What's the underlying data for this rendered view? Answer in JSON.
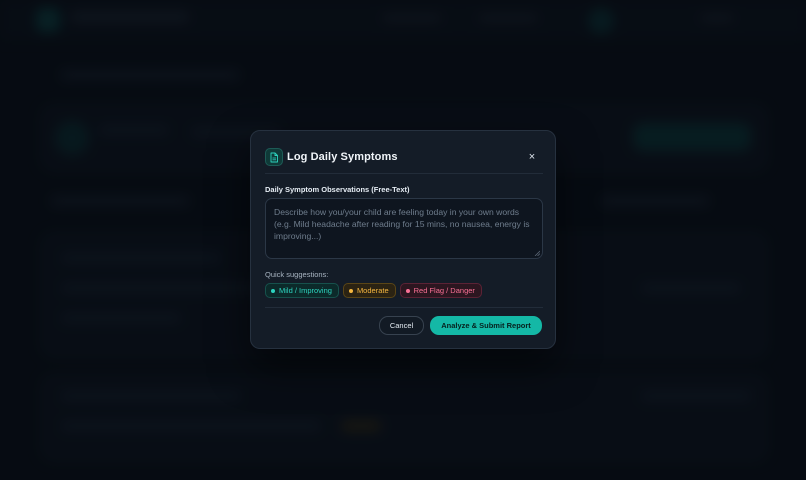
{
  "modal": {
    "title": "Log Daily Symptoms",
    "close_label": "×",
    "field_label": "Daily Symptom Observations (Free-Text)",
    "textarea_value": "",
    "textarea_placeholder": "Describe how you/your child are feeling today in your own words (e.g. Mild headache after reading for 15 mins, no nausea, energy is improving...)",
    "quick_label": "Quick suggestions:",
    "chips": [
      {
        "label": "Mild / Improving",
        "color": "#2dd4bf"
      },
      {
        "label": "Moderate",
        "color": "#f5b740"
      },
      {
        "label": "Red Flag / Danger",
        "color": "#fb7196"
      }
    ],
    "cancel_label": "Cancel",
    "submit_label": "Analyze & Submit Report",
    "icon": "document-icon"
  },
  "colors": {
    "accent": "#14b8a6",
    "modal_bg": "#141c27",
    "page_bg": "#0b1119"
  }
}
